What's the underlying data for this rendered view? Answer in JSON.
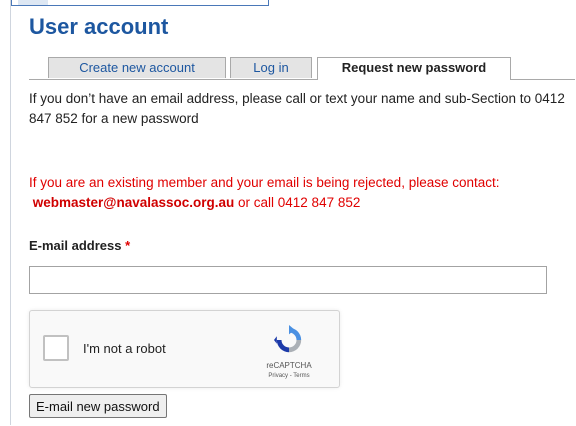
{
  "page": {
    "title": "User account"
  },
  "tabs": [
    {
      "label": "Create new account",
      "active": false
    },
    {
      "label": "Log in",
      "active": false
    },
    {
      "label": "Request new password",
      "active": true
    }
  ],
  "info": {
    "text": "If you don’t have an email address, please call or text your name and sub-Section to 0412 847 852 for a new password"
  },
  "warning": {
    "line1": "If you are an existing member and your email is being rejected, please contact:",
    "email": "webmaster@navalassoc.org.au",
    "line2_suffix": " or call 0412 847 852"
  },
  "form": {
    "email_label": "E-mail address",
    "required_marker": "*",
    "email_value": "",
    "submit_label": "E-mail new password"
  },
  "captcha": {
    "label": "I'm not a robot",
    "brand": "reCAPTCHA",
    "links": "Privacy - Terms"
  },
  "colors": {
    "title": "#1d57a0",
    "warning": "#e00000",
    "tab_inactive_bg": "#e4e4e4",
    "captcha_blue": "#1c3aa9",
    "captcha_light": "#4a90e2",
    "captcha_gray": "#abb0b6"
  }
}
